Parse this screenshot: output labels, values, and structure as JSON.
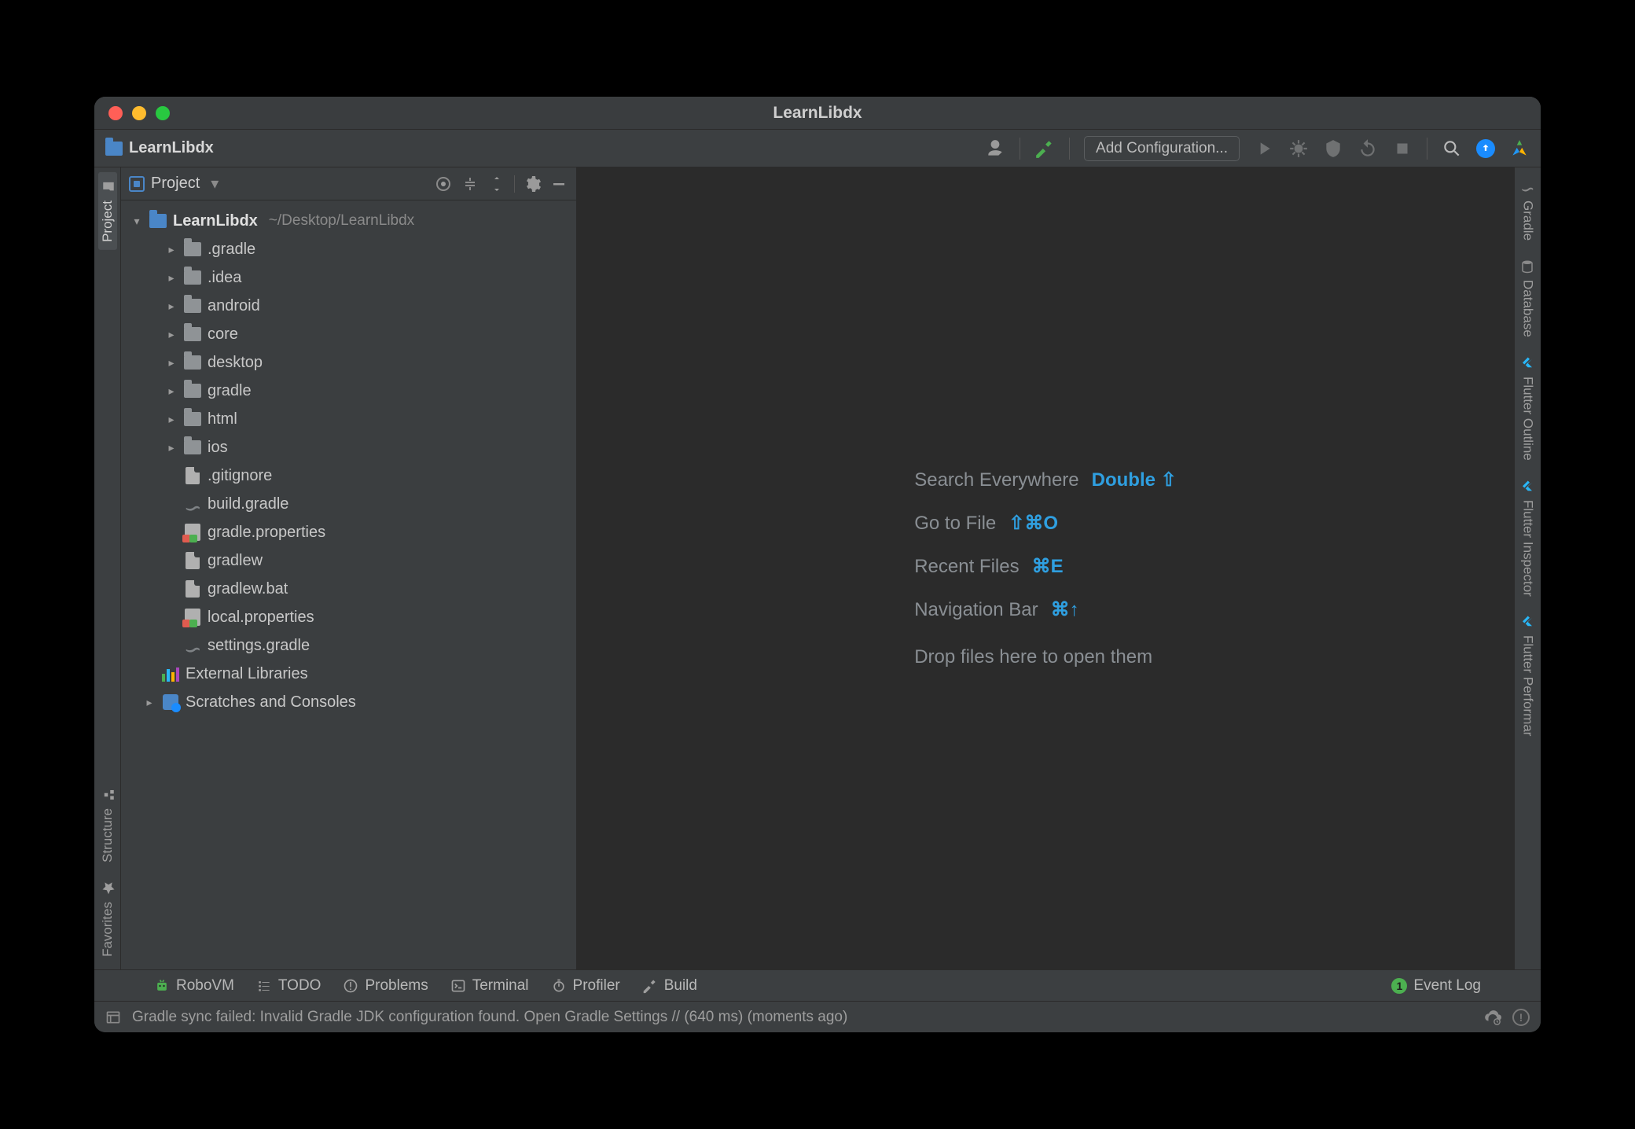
{
  "titlebar": {
    "title": "LearnLibdx"
  },
  "navbar": {
    "crumb": "LearnLibdx",
    "add_config": "Add Configuration..."
  },
  "left_rail": {
    "project": "Project",
    "structure": "Structure",
    "favorites": "Favorites"
  },
  "right_rail": {
    "gradle": "Gradle",
    "database": "Database",
    "flutter_outline": "Flutter Outline",
    "flutter_inspector": "Flutter Inspector",
    "flutter_performance": "Flutter Performar"
  },
  "proj_panel": {
    "title": "Project",
    "root": {
      "name": "LearnLibdx",
      "path": "~/Desktop/LearnLibdx"
    },
    "folders": [
      ".gradle",
      ".idea",
      "android",
      "core",
      "desktop",
      "gradle",
      "html",
      "ios"
    ],
    "files": [
      {
        "name": ".gitignore",
        "icon": "file"
      },
      {
        "name": "build.gradle",
        "icon": "gradle"
      },
      {
        "name": "gradle.properties",
        "icon": "prop"
      },
      {
        "name": "gradlew",
        "icon": "file"
      },
      {
        "name": "gradlew.bat",
        "icon": "file"
      },
      {
        "name": "local.properties",
        "icon": "prop"
      },
      {
        "name": "settings.gradle",
        "icon": "gradle"
      }
    ],
    "external": "External Libraries",
    "scratches": "Scratches and Consoles"
  },
  "editor_hints": {
    "search": {
      "label": "Search Everywhere",
      "key": "Double ⇧"
    },
    "goto": {
      "label": "Go to File",
      "key": "⇧⌘O"
    },
    "recent": {
      "label": "Recent Files",
      "key": "⌘E"
    },
    "navbar": {
      "label": "Navigation Bar",
      "key": "⌘↑"
    },
    "drop": "Drop files here to open them"
  },
  "bottom_tools": {
    "robovm": "RoboVM",
    "todo": "TODO",
    "problems": "Problems",
    "terminal": "Terminal",
    "profiler": "Profiler",
    "build": "Build",
    "eventlog": "Event Log",
    "eventlog_count": "1"
  },
  "statusbar": {
    "msg": "Gradle sync failed: Invalid Gradle JDK configuration found. Open Gradle Settings // (640 ms) (moments ago)"
  }
}
